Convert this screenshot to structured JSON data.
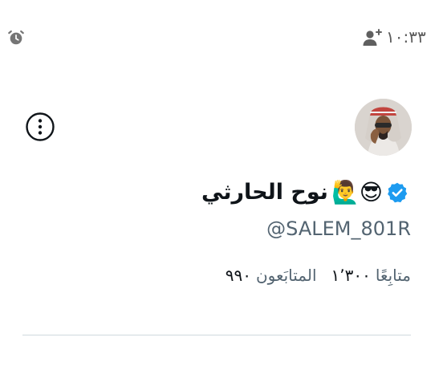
{
  "status_bar": {
    "time": "١٠:٣٣",
    "alarm_icon": "alarm-clock-icon",
    "notification_icon": "add-user-icon"
  },
  "profile": {
    "display_name": "نوح الحارثي",
    "name_emojis": "😎🙋‍♂️",
    "verified": true,
    "handle": "@SALEM_801R",
    "following": {
      "count": "٩٩٠",
      "label": "المتابَعون"
    },
    "followers": {
      "count": "١٬٣٠٠",
      "label": "متابِعًا"
    }
  },
  "colors": {
    "verified_blue": "#1d9bf0",
    "text_primary": "#0f1419",
    "text_secondary": "#536471",
    "divider": "#cfd9de"
  }
}
